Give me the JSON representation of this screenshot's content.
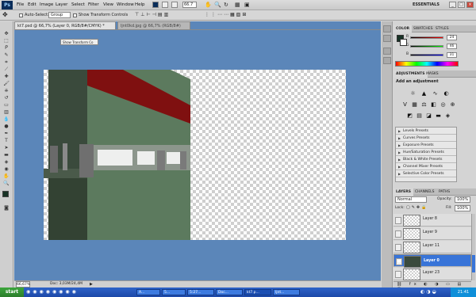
{
  "app": {
    "logo": "Ps",
    "workspace": "ESSENTIALS",
    "zoom": "66.7"
  },
  "menu": [
    "File",
    "Edit",
    "Image",
    "Layer",
    "Select",
    "Filter",
    "View",
    "Window",
    "Help"
  ],
  "options_bar": {
    "auto_select_label": "Auto-Select:",
    "auto_select_value": "Group",
    "show_transform_label": "Show Transform Controls"
  },
  "tooltip": "Show Transform Co",
  "doc_tabs": [
    {
      "label": "kt7.psd @ 66,7% (Layer 0, RGB/8#/CMYK) *",
      "active": true
    },
    {
      "label": "ljnt0kd.jpg @ 66,7% (RGB/8#)",
      "active": false
    }
  ],
  "status": {
    "zoom": "66,67%",
    "doc": "Doc: 3,03M/24,4M"
  },
  "color_panel": {
    "tabs": [
      "COLOR",
      "SWATCHES",
      "STYLES"
    ],
    "channels": [
      {
        "label": "R",
        "value": "24"
      },
      {
        "label": "G",
        "value": "46"
      },
      {
        "label": "B",
        "value": "31"
      }
    ]
  },
  "adjustments_panel": {
    "tabs": [
      "ADJUSTMENTS",
      "MASKS"
    ],
    "title": "Add an adjustment",
    "presets": [
      "Levels Presets",
      "Curves Presets",
      "Exposure Presets",
      "Hue/Saturation Presets",
      "Black & White Presets",
      "Channel Mixer Presets",
      "Selective Color Presets"
    ]
  },
  "layers_panel": {
    "tabs": [
      "LAYERS",
      "CHANNELS",
      "PATHS"
    ],
    "blend_mode": "Normal",
    "opacity_label": "Opacity:",
    "opacity": "100%",
    "lock_label": "Lock:",
    "fill_label": "Fill:",
    "fill": "100%",
    "layers": [
      {
        "name": "Layer 8",
        "visible": false,
        "selected": false
      },
      {
        "name": "Layer 9",
        "visible": false,
        "selected": false
      },
      {
        "name": "Layer 11",
        "visible": false,
        "selected": false
      },
      {
        "name": "Layer 0",
        "visible": true,
        "selected": true
      },
      {
        "name": "Layer 23",
        "visible": false,
        "selected": false
      }
    ]
  },
  "taskbar": {
    "start": "start",
    "buttons": [
      "A...",
      "5...",
      "5:27...",
      "Doc...",
      "kt7.p...",
      "ljnt..."
    ],
    "clock": "21:41"
  },
  "colors": {
    "accent": "#3874d8",
    "canvas_bg": "#5b86b9",
    "building_green": "#5c7a5e",
    "stripe_red": "#7f1010"
  }
}
